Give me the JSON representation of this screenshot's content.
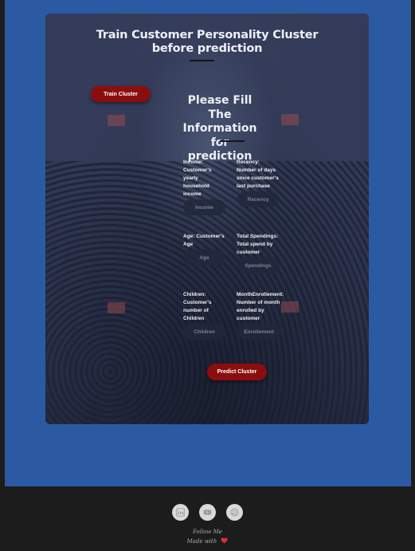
{
  "header": {
    "title_line1": "Train Customer Personality Cluster",
    "title_line2": "before prediction"
  },
  "train_button": {
    "label": "Train Cluster"
  },
  "form": {
    "title_line1": "Please Fill The",
    "title_line2": "Information for",
    "title_line3": "prediction",
    "income": {
      "label_lines": [
        "Income:",
        "Customer's",
        "yearly",
        "household",
        "income"
      ],
      "placeholder": "Income"
    },
    "recency": {
      "label_lines": [
        "Recency:",
        "Number of days",
        "since customer's",
        "last purchase"
      ],
      "placeholder": "Recency"
    },
    "age": {
      "label_lines": [
        "Age: Customer's",
        "Age"
      ],
      "placeholder": "Age"
    },
    "spendings": {
      "label_lines": [
        "Total Spendings:",
        "Total spend by",
        "customer"
      ],
      "placeholder": "Spendings"
    },
    "children": {
      "label_lines": [
        "Children:",
        "Customer's",
        "number of",
        "Children"
      ],
      "placeholder": "Children"
    },
    "enrollment": {
      "label_lines": [
        "MonthEnrollement:",
        "Number of month",
        "enrolled by",
        "customer"
      ],
      "placeholder": "Enrollement"
    },
    "predict_button": {
      "label": "Predict Cluster"
    }
  },
  "footer": {
    "social_icons": [
      "linkedin-icon",
      "youtube-icon",
      "github-icon"
    ],
    "follow_text": "Follow Me",
    "made_with_text": "Made with",
    "heart_color": "#e0322e"
  },
  "colors": {
    "page_background": "#1c1c1c",
    "outer_panel": "#2b5aa3",
    "card": "#333b58",
    "button_red": "#8a0e0e"
  }
}
